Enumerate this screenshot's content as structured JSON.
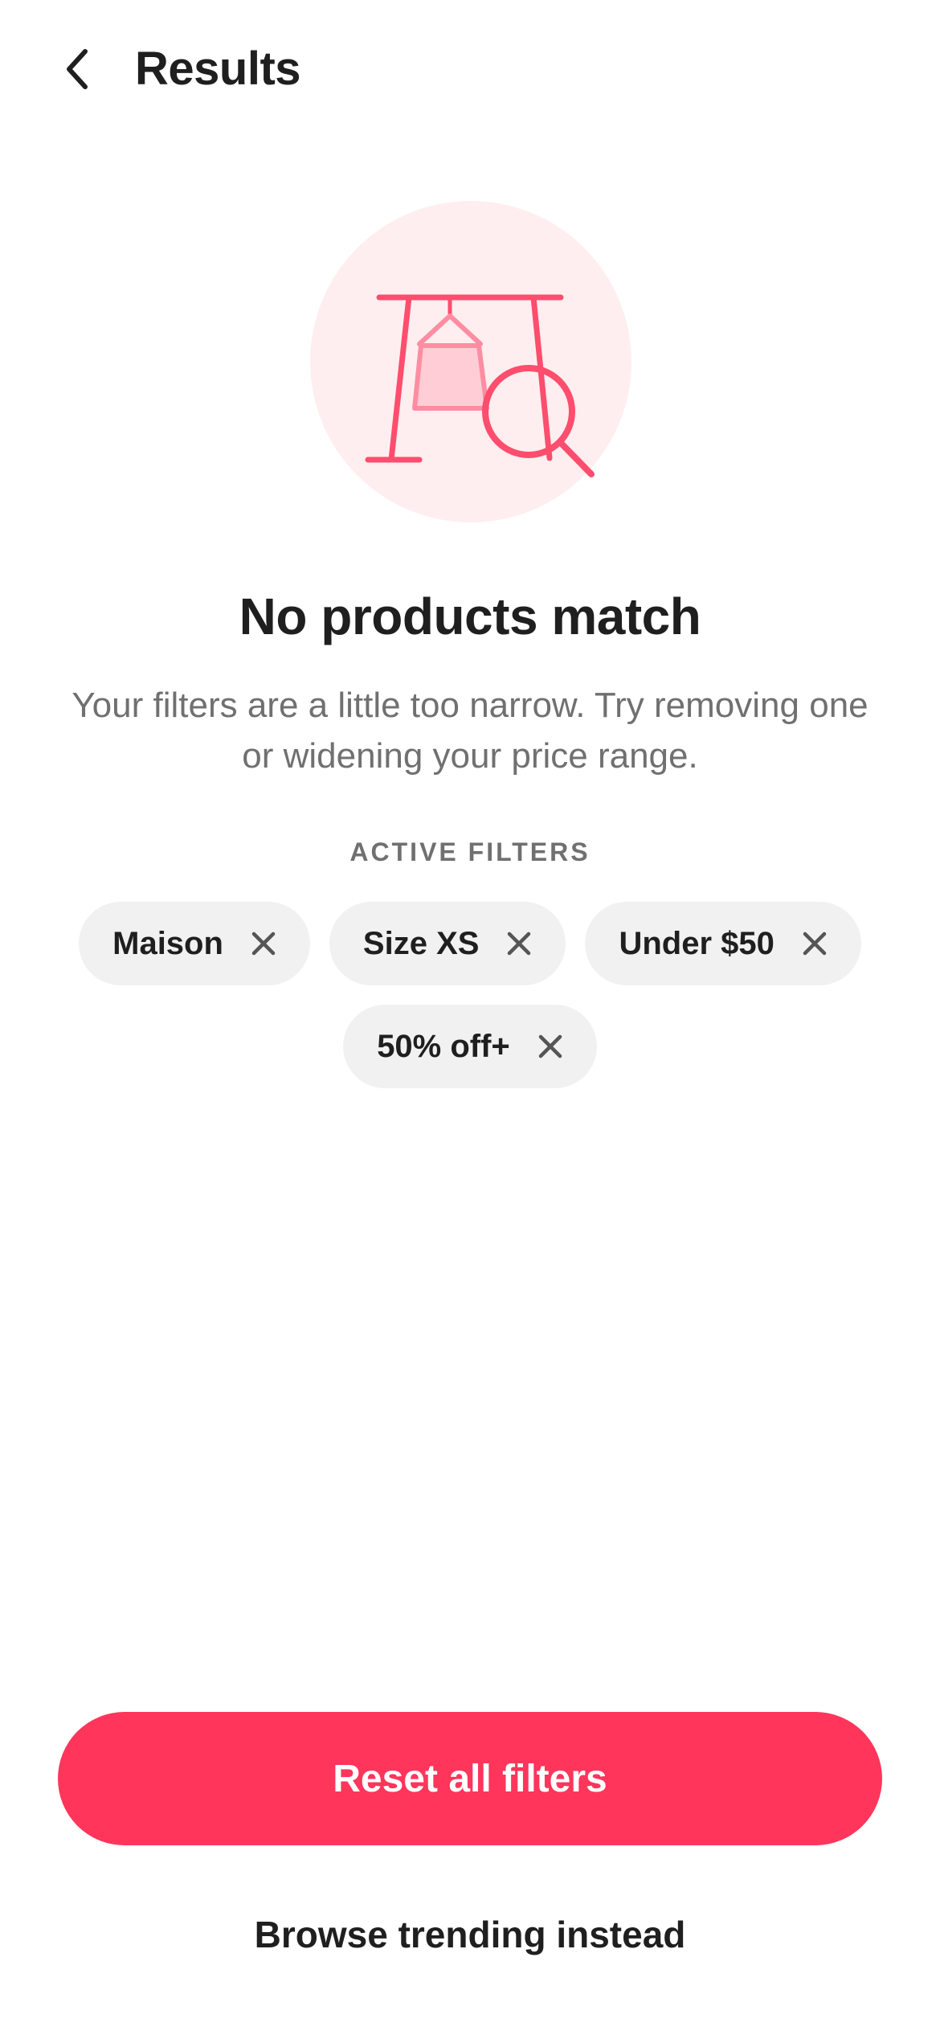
{
  "header": {
    "title": "Results",
    "back_icon": "chevron-left-icon"
  },
  "illustration": {
    "icon": "clothing-rack-search-icon",
    "colors": {
      "circle_bg": "#ffeef0",
      "stroke": "#ff4d6d",
      "fill": "#ffcdd5"
    }
  },
  "empty_state": {
    "title": "No products match",
    "subtitle": "Your filters are a little too narrow. Try removing one or widening your price range."
  },
  "active_filters": {
    "label": "ACTIVE FILTERS",
    "chips": [
      {
        "label": "Maison",
        "remove_icon": "close-icon"
      },
      {
        "label": "Size XS",
        "remove_icon": "close-icon"
      },
      {
        "label": "Under $50",
        "remove_icon": "close-icon"
      },
      {
        "label": "50% off+",
        "remove_icon": "close-icon"
      }
    ]
  },
  "actions": {
    "primary_label": "Reset all filters",
    "secondary_label": "Browse trending instead"
  },
  "colors": {
    "accent": "#ff355b",
    "chip_bg": "#f1f1f1",
    "text_primary": "#1f1f1f",
    "text_secondary": "#707070"
  }
}
